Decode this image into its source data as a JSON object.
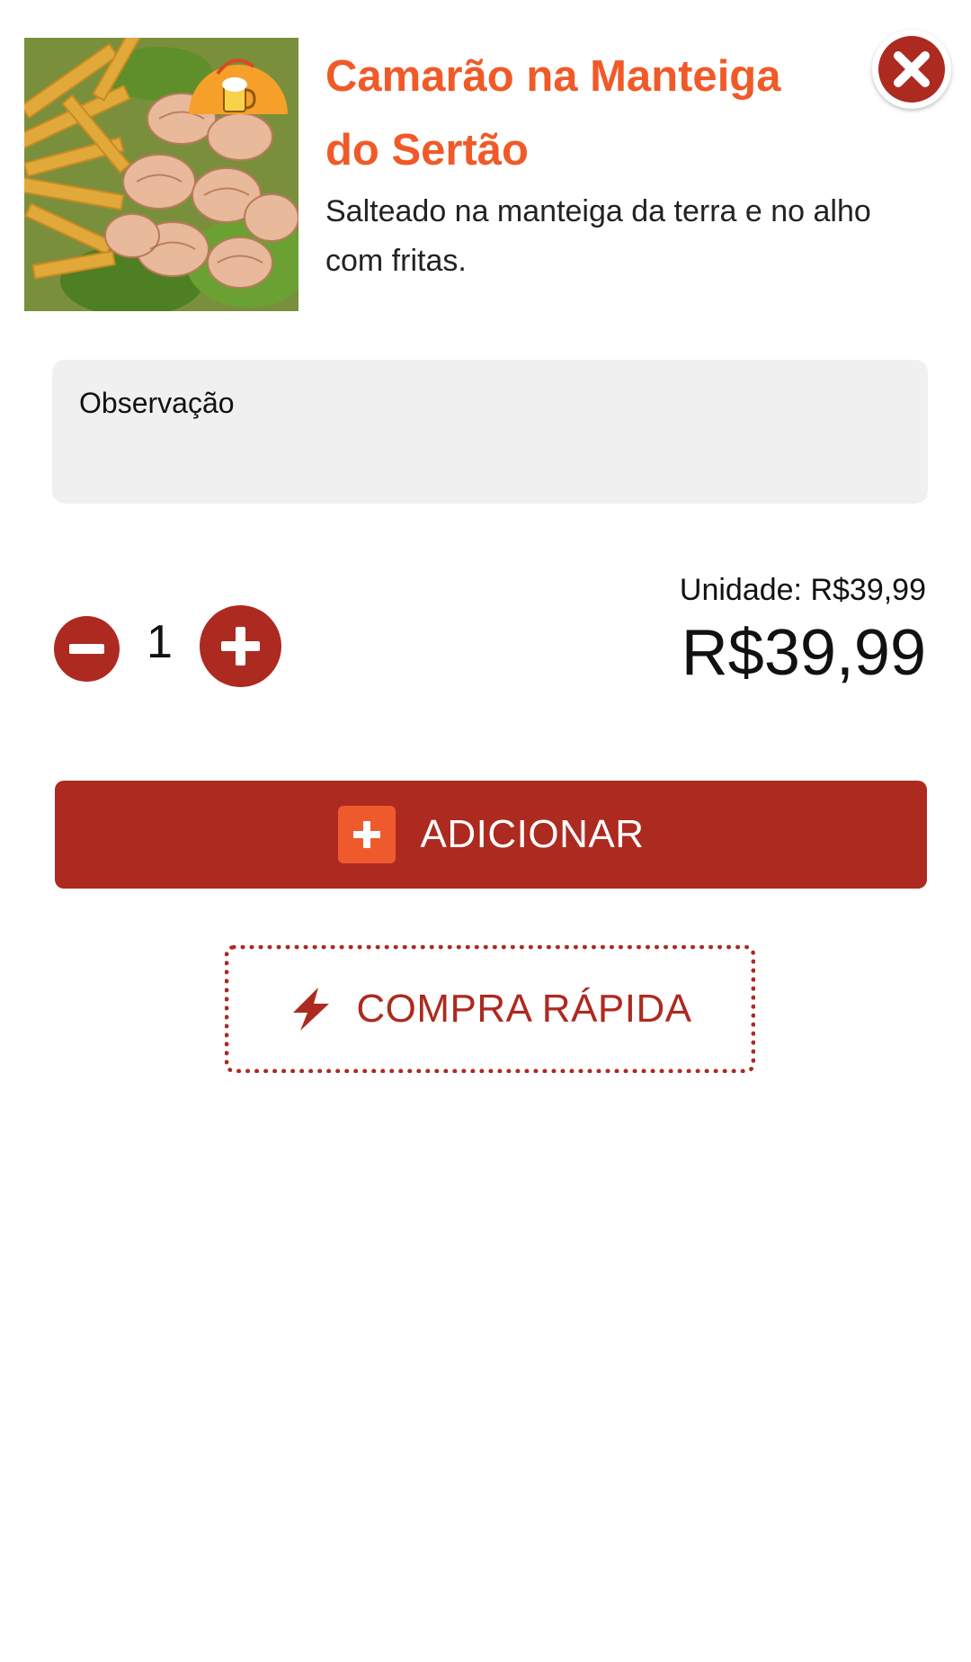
{
  "product": {
    "title": "Camarão na Manteiga do Sertão",
    "description": "Salteado na manteiga da terra e no alho com fritas.",
    "image_icon": "shrimp-fries-photo"
  },
  "observation": {
    "placeholder": "Observação",
    "value": ""
  },
  "quantity": {
    "value": "1",
    "minus_icon": "minus-circle-icon",
    "plus_icon": "plus-circle-icon"
  },
  "price": {
    "unit_label": "Unidade: R$39,99",
    "total": "R$39,99"
  },
  "actions": {
    "add_label": "ADICIONAR",
    "add_icon": "plus-square-icon",
    "quick_buy_label": "COMPRA RÁPIDA",
    "quick_buy_icon": "lightning-bolt-icon",
    "close_icon": "close-circle-icon"
  },
  "colors": {
    "title": "#f05a28",
    "primary": "#ad2a20",
    "accent": "#ef5a2d",
    "field_background": "#f0f0f0"
  }
}
